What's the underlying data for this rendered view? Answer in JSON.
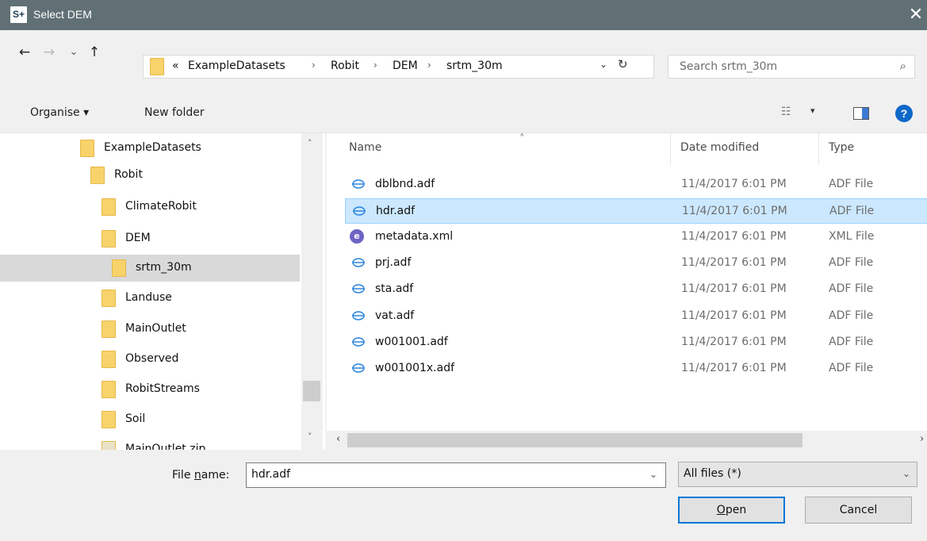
{
  "window": {
    "title": "Select DEM",
    "app_logo": "S+",
    "close_glyph": "✕"
  },
  "nav": {
    "back_glyph": "←",
    "forward_glyph": "→",
    "recent_glyph": "⌄",
    "up_glyph": "↑"
  },
  "address": {
    "overflow": "«",
    "crumbs": [
      "ExampleDatasets",
      "Robit",
      "DEM",
      "srtm_30m"
    ],
    "separator": "›",
    "dropdown_glyph": "⌄",
    "refresh_glyph": "↻"
  },
  "search": {
    "placeholder": "Search srtm_30m",
    "icon_glyph": "⌕"
  },
  "toolbar": {
    "organise_label": "Organise ▾",
    "new_folder_label": "New folder",
    "view_glyph": "☷",
    "view_caret": "▾",
    "help_glyph": "?"
  },
  "tree": {
    "items": [
      {
        "label": "ExampleDatasets",
        "selected": false
      },
      {
        "label": "Robit",
        "selected": false
      },
      {
        "label": "ClimateRobit",
        "selected": false
      },
      {
        "label": "DEM",
        "selected": false
      },
      {
        "label": "srtm_30m",
        "selected": true
      },
      {
        "label": "Landuse",
        "selected": false
      },
      {
        "label": "MainOutlet",
        "selected": false
      },
      {
        "label": "Observed",
        "selected": false
      },
      {
        "label": "RobitStreams",
        "selected": false
      },
      {
        "label": "Soil",
        "selected": false
      },
      {
        "label": "MainOutlet.zip",
        "selected": false
      }
    ],
    "scroll_up": "˄",
    "scroll_down": "˅"
  },
  "files": {
    "sort_glyph": "˄",
    "columns": {
      "name": "Name",
      "date": "Date modified",
      "type": "Type"
    },
    "rows": [
      {
        "name": "dblbnd.adf",
        "date": "11/4/2017 6:01 PM",
        "type": "ADF File",
        "icon": "adf-icon",
        "selected": false
      },
      {
        "name": "hdr.adf",
        "date": "11/4/2017 6:01 PM",
        "type": "ADF File",
        "icon": "adf-icon",
        "selected": true
      },
      {
        "name": "metadata.xml",
        "date": "11/4/2017 6:01 PM",
        "type": "XML File",
        "icon": "xml-icon",
        "selected": false
      },
      {
        "name": "prj.adf",
        "date": "11/4/2017 6:01 PM",
        "type": "ADF File",
        "icon": "adf-icon",
        "selected": false
      },
      {
        "name": "sta.adf",
        "date": "11/4/2017 6:01 PM",
        "type": "ADF File",
        "icon": "adf-icon",
        "selected": false
      },
      {
        "name": "vat.adf",
        "date": "11/4/2017 6:01 PM",
        "type": "ADF File",
        "icon": "adf-icon",
        "selected": false
      },
      {
        "name": "w001001.adf",
        "date": "11/4/2017 6:01 PM",
        "type": "ADF File",
        "icon": "adf-icon",
        "selected": false
      },
      {
        "name": "w001001x.adf",
        "date": "11/4/2017 6:01 PM",
        "type": "ADF File",
        "icon": "adf-icon",
        "selected": false
      }
    ],
    "hscroll_left": "‹",
    "hscroll_right": "›"
  },
  "footer": {
    "file_name_label_pre": "File ",
    "file_name_label_accel": "n",
    "file_name_label_post": "ame:",
    "file_name_value": "hdr.adf",
    "file_type_value": "All files  (*)",
    "dropdown_glyph": "⌄",
    "open_label_accel": "O",
    "open_label_rest": "pen",
    "cancel_label": "Cancel"
  },
  "colors": {
    "titlebar": "#607074",
    "selection_bg": "#cce8ff",
    "selection_border": "#99d1ff",
    "primary_button_border": "#0078d7",
    "folder": "#f8d36b"
  }
}
